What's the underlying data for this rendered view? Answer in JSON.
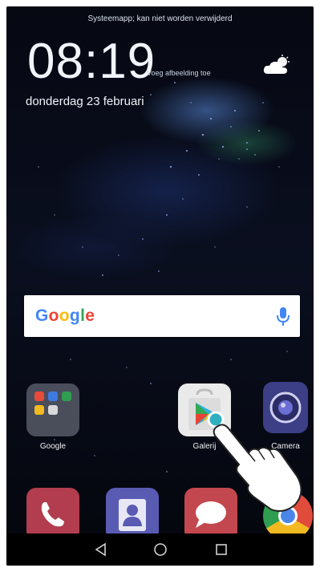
{
  "notification": {
    "toast": "Systeemapp; kan niet worden verwijderd"
  },
  "lockscreen": {
    "time": "08:19",
    "time_hint": "Voeg afbeelding toe",
    "date": "donderdag 23 februari",
    "weather_icon": "partly-cloudy-icon"
  },
  "search": {
    "logo": "Google",
    "mic_icon": "microphone-icon",
    "colors": [
      "#4285F4",
      "#EA4335",
      "#FBBC05",
      "#4285F4",
      "#34A853",
      "#EA4335"
    ]
  },
  "apps": [
    {
      "label": "Google",
      "icon": "folder-icon"
    },
    {
      "label": "Galerij",
      "icon": "play-store-icon"
    },
    {
      "label": "Camera",
      "icon": "camera-icon"
    }
  ],
  "dock": [
    {
      "icon": "phone-icon"
    },
    {
      "icon": "contacts-icon"
    },
    {
      "icon": "messages-icon"
    },
    {
      "icon": "chrome-icon"
    }
  ],
  "navbar": {
    "back_icon": "back-triangle-icon",
    "home_icon": "home-circle-icon",
    "recents_icon": "recents-square-icon"
  }
}
